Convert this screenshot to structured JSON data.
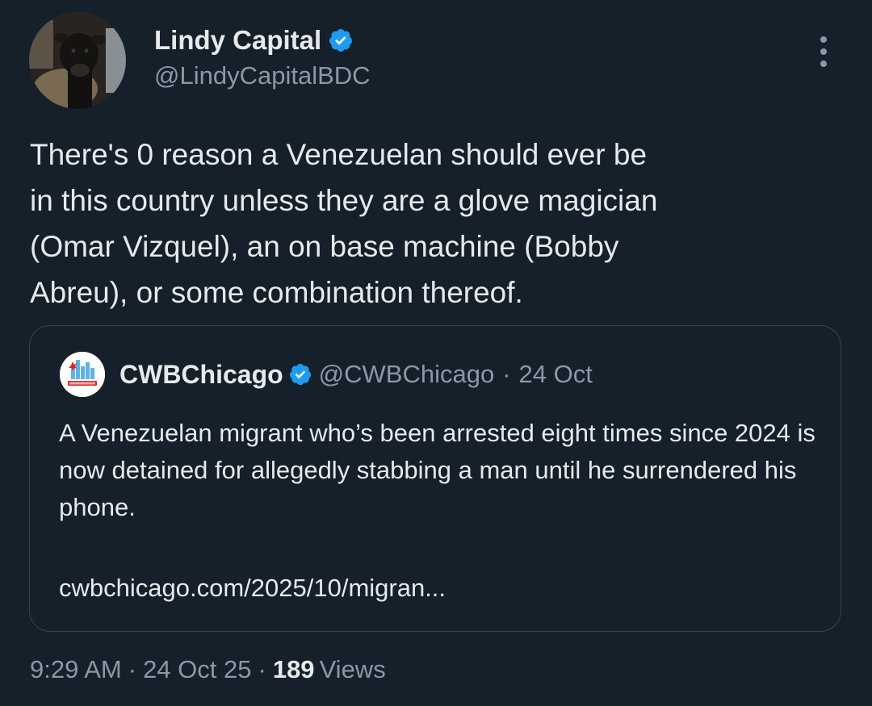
{
  "author": {
    "display_name": "Lindy Capital",
    "handle": "@LindyCapitalBDC",
    "verified_color": "#1d9bf0"
  },
  "tweet": {
    "text": "There's 0 reason a Venezuelan should ever be\nin this country unless they are a glove magician\n(Omar Vizquel), an on base machine (Bobby\nAbreu), or some combination thereof."
  },
  "quoted_tweet": {
    "display_name": "CWBChicago",
    "handle": "@CWBChicago",
    "separator": "·",
    "date": "24 Oct",
    "text": "A Venezuelan migrant who’s been arrested eight times since 2024 is now detained for allegedly stabbing a man until he surrendered his phone.",
    "link": "cwbchicago.com/2025/10/migran..."
  },
  "meta": {
    "time": "9:29 AM",
    "separator": "·",
    "date": "24 Oct 25",
    "views_count": "189",
    "views_label": "Views"
  },
  "icons": {
    "more": "more-vertical-icon",
    "verified": "verified-badge-icon"
  },
  "colors": {
    "background": "#15202b",
    "primary_text": "#e7e9ea",
    "secondary_text": "#8b98a5",
    "border": "#38444d",
    "accent": "#1d9bf0"
  }
}
